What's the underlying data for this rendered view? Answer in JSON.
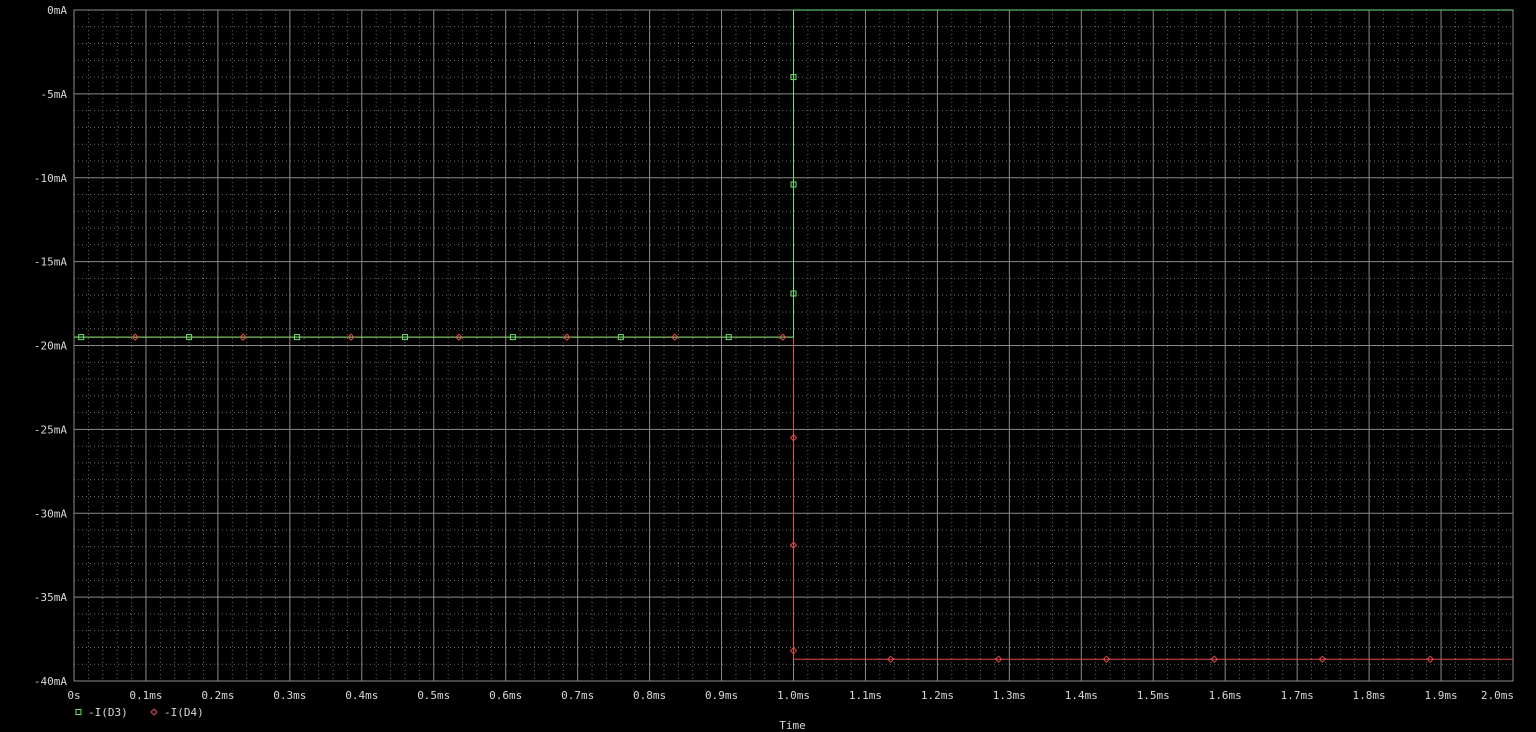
{
  "chart_data": {
    "type": "line",
    "title": "",
    "xlabel": "Time",
    "ylabel": "",
    "xlim": [
      0,
      2.0
    ],
    "ylim": [
      -40,
      0
    ],
    "x_unit": "ms",
    "y_unit": "mA",
    "grid": true,
    "x_ticks": [
      0,
      0.1,
      0.2,
      0.3,
      0.4,
      0.5,
      0.6,
      0.7,
      0.8,
      0.9,
      1.0,
      1.1,
      1.2,
      1.3,
      1.4,
      1.5,
      1.6,
      1.7,
      1.8,
      1.9,
      2.0
    ],
    "x_tick_labels": [
      "0s",
      "0.1ms",
      "0.2ms",
      "0.3ms",
      "0.4ms",
      "0.5ms",
      "0.6ms",
      "0.7ms",
      "0.8ms",
      "0.9ms",
      "1.0ms",
      "1.1ms",
      "1.2ms",
      "1.3ms",
      "1.4ms",
      "1.5ms",
      "1.6ms",
      "1.7ms",
      "1.8ms",
      "1.9ms",
      "2.0ms"
    ],
    "y_ticks": [
      0,
      -5,
      -10,
      -15,
      -20,
      -25,
      -30,
      -35,
      -40
    ],
    "y_tick_labels": [
      "0mA",
      "-5mA",
      "-10mA",
      "-15mA",
      "-20mA",
      "-25mA",
      "-30mA",
      "-35mA",
      "-40mA"
    ],
    "legend_position": "bottom-left",
    "series": [
      {
        "name": "-I(D3)",
        "color": "#6fe36f",
        "marker": "square",
        "x": [
          0,
          1.0,
          1.0,
          1.0,
          1.0,
          1.0,
          2.0
        ],
        "y": [
          -19.5,
          -19.5,
          -16.9,
          -10.4,
          -4.0,
          0,
          0
        ],
        "marker_x": [
          0.01,
          0.16,
          0.31,
          0.46,
          0.61,
          0.76,
          0.91,
          1.0,
          1.0,
          1.0
        ],
        "marker_y": [
          -19.5,
          -19.5,
          -19.5,
          -19.5,
          -19.5,
          -19.5,
          -19.5,
          -16.9,
          -10.4,
          -4.0
        ]
      },
      {
        "name": "-I(D4)",
        "color": "#e04a4a",
        "marker": "diamond",
        "x": [
          0,
          1.0,
          1.0,
          1.0,
          1.0,
          1.0,
          2.0
        ],
        "y": [
          -19.5,
          -19.5,
          -25.5,
          -31.9,
          -38.2,
          -38.7,
          -38.7
        ],
        "marker_x": [
          0.085,
          0.235,
          0.385,
          0.535,
          0.685,
          0.835,
          0.985,
          1.0,
          1.0,
          1.0,
          1.135,
          1.285,
          1.435,
          1.585,
          1.735,
          1.885
        ],
        "marker_y": [
          -19.5,
          -19.5,
          -19.5,
          -19.5,
          -19.5,
          -19.5,
          -19.5,
          -25.5,
          -31.9,
          -38.2,
          -38.7,
          -38.7,
          -38.7,
          -38.7,
          -38.7,
          -38.7
        ]
      }
    ]
  }
}
